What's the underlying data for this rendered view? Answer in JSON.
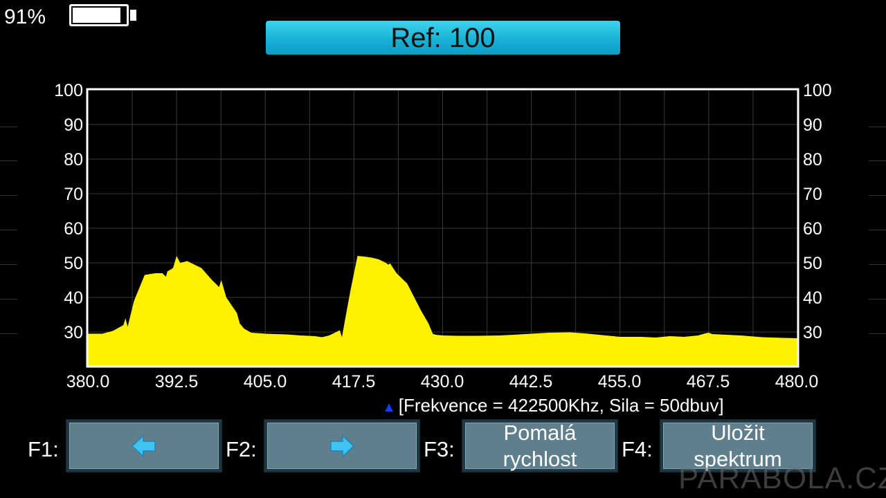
{
  "status": {
    "battery_text": "91%",
    "battery_level": 0.91
  },
  "header": {
    "ref_label": "Ref: 100"
  },
  "colors": {
    "trace": "#fff200",
    "marker": "#1a3cff",
    "ref_bar": "#1fb9dd",
    "button": "#5f7f8d"
  },
  "chart_data": {
    "type": "area",
    "xlim": [
      380.0,
      480.0
    ],
    "ylim": [
      20,
      100
    ],
    "x_ticks": [
      "380.0",
      "392.5",
      "405.0",
      "417.5",
      "430.0",
      "442.5",
      "455.0",
      "467.5",
      "480.0"
    ],
    "y_ticks": [
      "100",
      "90",
      "80",
      "70",
      "60",
      "50",
      "40",
      "30"
    ],
    "grid": true,
    "x": [
      380,
      382,
      383.5,
      385,
      385.3,
      385.6,
      386.5,
      388,
      389.5,
      390.5,
      391,
      391.2,
      392,
      392.5,
      393,
      394,
      396,
      397.5,
      398.5,
      398.8,
      399.5,
      400,
      400.5,
      401,
      401.4,
      402,
      403,
      405,
      408,
      410,
      412,
      413,
      414,
      415.5,
      415.8,
      416.2,
      417,
      418,
      419,
      420,
      421,
      422,
      422.3,
      422.6,
      423.5,
      425,
      426,
      427,
      428,
      428.6,
      429,
      430,
      432,
      435,
      438,
      440,
      442.5,
      445,
      448,
      450,
      452,
      455,
      458,
      460,
      462,
      464,
      466,
      467,
      467.5,
      468,
      470,
      472,
      475,
      478,
      480
    ],
    "values": [
      29.5,
      29.5,
      30.3,
      32,
      34,
      31.5,
      39,
      46.5,
      47,
      47,
      46,
      47.5,
      48.5,
      52,
      50,
      50.5,
      48.5,
      45,
      43,
      45,
      40,
      38.5,
      37,
      35.5,
      32.5,
      31,
      29.8,
      29.5,
      29.3,
      29.0,
      28.8,
      28.5,
      29.0,
      30.5,
      28.5,
      33,
      42,
      52,
      51.8,
      51.5,
      51,
      50,
      49.5,
      49.8,
      47,
      44,
      40,
      36,
      32.5,
      29.5,
      29.2,
      29,
      28.9,
      28.9,
      29.0,
      29.2,
      29.5,
      29.8,
      29.9,
      29.6,
      29.2,
      28.6,
      28.6,
      28.4,
      28.8,
      28.6,
      29.0,
      29.6,
      29.8,
      29.4,
      29.2,
      29.0,
      28.5,
      28.3,
      28.2
    ]
  },
  "readout": {
    "marker_glyph": "▲",
    "text": "[Frekvence = 422500Khz, Sila = 50dbuv]"
  },
  "function_keys": [
    {
      "key": "F1:",
      "icon": "arrow-left-icon",
      "label": ""
    },
    {
      "key": "F2:",
      "icon": "arrow-right-icon",
      "label": ""
    },
    {
      "key": "F3:",
      "icon": "",
      "label": "Pomalá\nrychlost"
    },
    {
      "key": "F4:",
      "icon": "",
      "label": "Uložit\nspektrum"
    }
  ],
  "watermark": "PARABOLA.CZ"
}
